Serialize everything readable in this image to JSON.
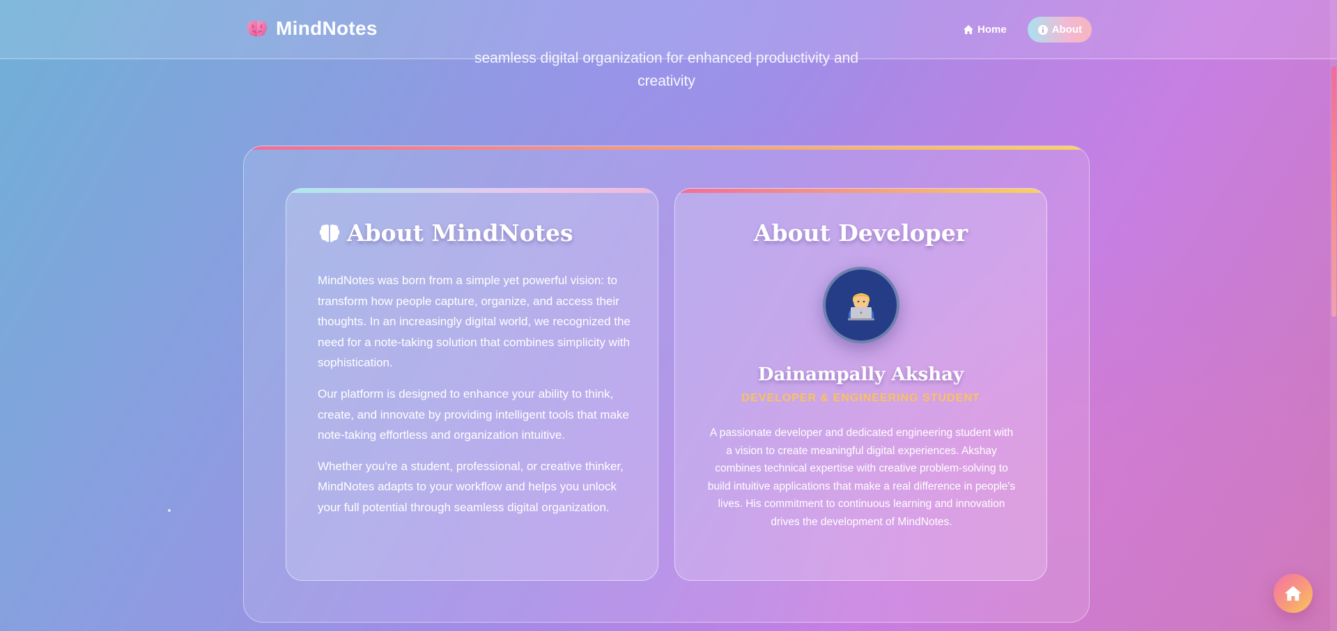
{
  "header": {
    "brand_name": "MindNotes",
    "brand_icon": "brain-icon",
    "nav": [
      {
        "label": "Home",
        "icon": "home-icon",
        "active": false
      },
      {
        "label": "About",
        "icon": "info-icon",
        "active": true
      }
    ]
  },
  "hero": {
    "subtitle_line1": "seamless digital organization for enhanced productivity and",
    "subtitle_line2": "creativity"
  },
  "about_card": {
    "title": "About MindNotes",
    "title_icon": "brain-icon",
    "paragraphs": [
      "MindNotes was born from a simple yet powerful vision: to transform how people capture, organize, and access their thoughts. In an increasingly digital world, we recognized the need for a note-taking solution that combines simplicity with sophistication.",
      "Our platform is designed to enhance your ability to think, create, and innovate by providing intelligent tools that make note-taking effortless and organization intuitive.",
      "Whether you're a student, professional, or creative thinker, MindNotes adapts to your workflow and helps you unlock your full potential through seamless digital organization."
    ]
  },
  "developer_card": {
    "title": "About Developer",
    "avatar_emoji": "🧑‍💻",
    "name": "Dainampally Akshay",
    "role": "DEVELOPER & ENGINEERING STUDENT",
    "bio": "A passionate developer and dedicated engineering student with a vision to create meaningful digital experiences. Akshay combines technical expertise with creative problem-solving to build intuitive applications that make a real difference in people's lives. His commitment to continuous learning and innovation drives the development of MindNotes."
  },
  "fab": {
    "icon": "home-icon"
  },
  "colors": {
    "accent_gold": "#f7c35c",
    "accent_pink": "#f06d9a",
    "avatar_bg": "#243d86"
  }
}
